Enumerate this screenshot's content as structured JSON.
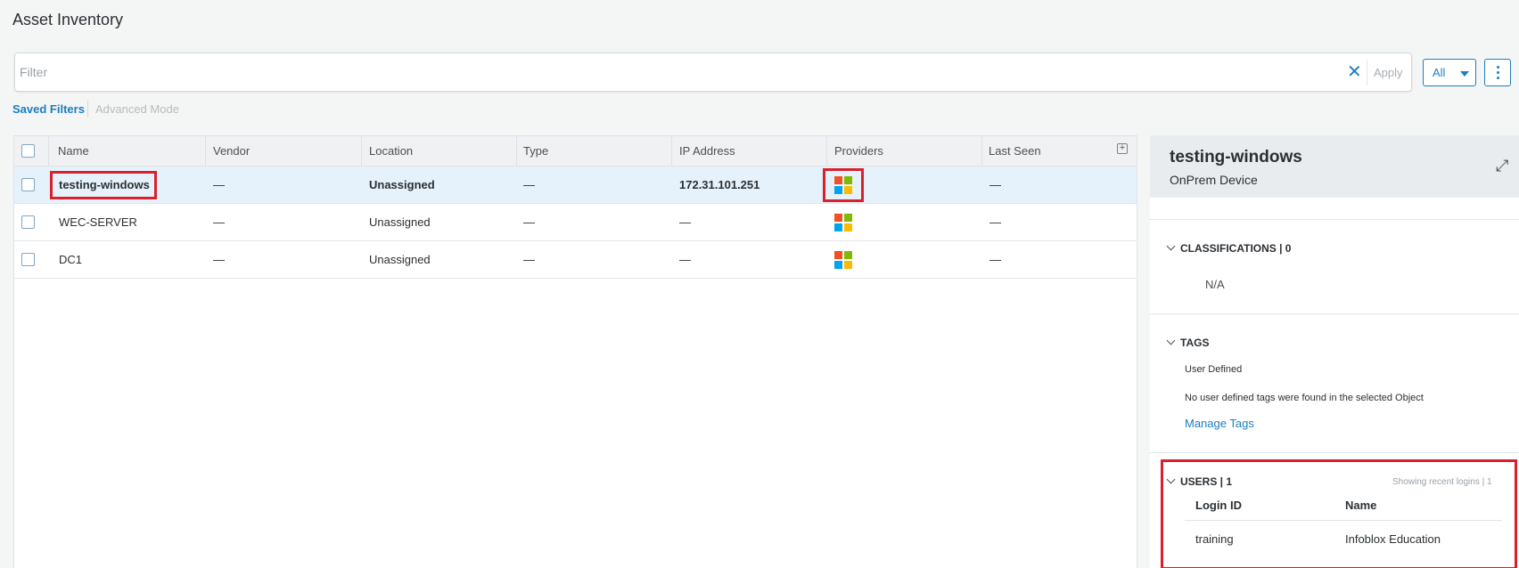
{
  "page": {
    "title": "Asset Inventory"
  },
  "filter": {
    "placeholder": "Filter",
    "clear_label": "✕",
    "apply_label": "Apply",
    "scope_label": "All"
  },
  "subnav": {
    "saved_filters": "Saved Filters",
    "advanced_mode": "Advanced Mode"
  },
  "table": {
    "columns": [
      "Name",
      "Vendor",
      "Location",
      "Type",
      "IP Address",
      "Providers",
      "Last Seen"
    ],
    "rows": [
      {
        "name": "testing-windows",
        "vendor": "—",
        "location": "Unassigned",
        "type": "—",
        "ip": "172.31.101.251",
        "provider_icon": "microsoft-logo-icon",
        "last_seen": "—",
        "selected": true
      },
      {
        "name": "WEC-SERVER",
        "vendor": "—",
        "location": "Unassigned",
        "type": "—",
        "ip": "—",
        "provider_icon": "microsoft-logo-icon",
        "last_seen": "—",
        "selected": false
      },
      {
        "name": "DC1",
        "vendor": "—",
        "location": "Unassigned",
        "type": "—",
        "ip": "—",
        "provider_icon": "microsoft-logo-icon",
        "last_seen": "—",
        "selected": false
      }
    ]
  },
  "panel": {
    "title": "testing-windows",
    "subtitle": "OnPrem Device",
    "classifications": {
      "title": "CLASSIFICATIONS | 0",
      "value": "N/A"
    },
    "tags": {
      "title": "TAGS",
      "group": "User Defined",
      "empty_text": "No user defined tags were found in the selected Object",
      "manage_link": "Manage Tags"
    },
    "users": {
      "title": "USERS | 1",
      "note": "Showing recent logins | 1",
      "columns": [
        "Login ID",
        "Name"
      ],
      "rows": [
        {
          "login_id": "training",
          "name": "Infoblox Education"
        }
      ]
    }
  },
  "colors": {
    "accent": "#1a7fc1",
    "highlight": "#d9202c",
    "selected_row": "#e6f2fb"
  }
}
